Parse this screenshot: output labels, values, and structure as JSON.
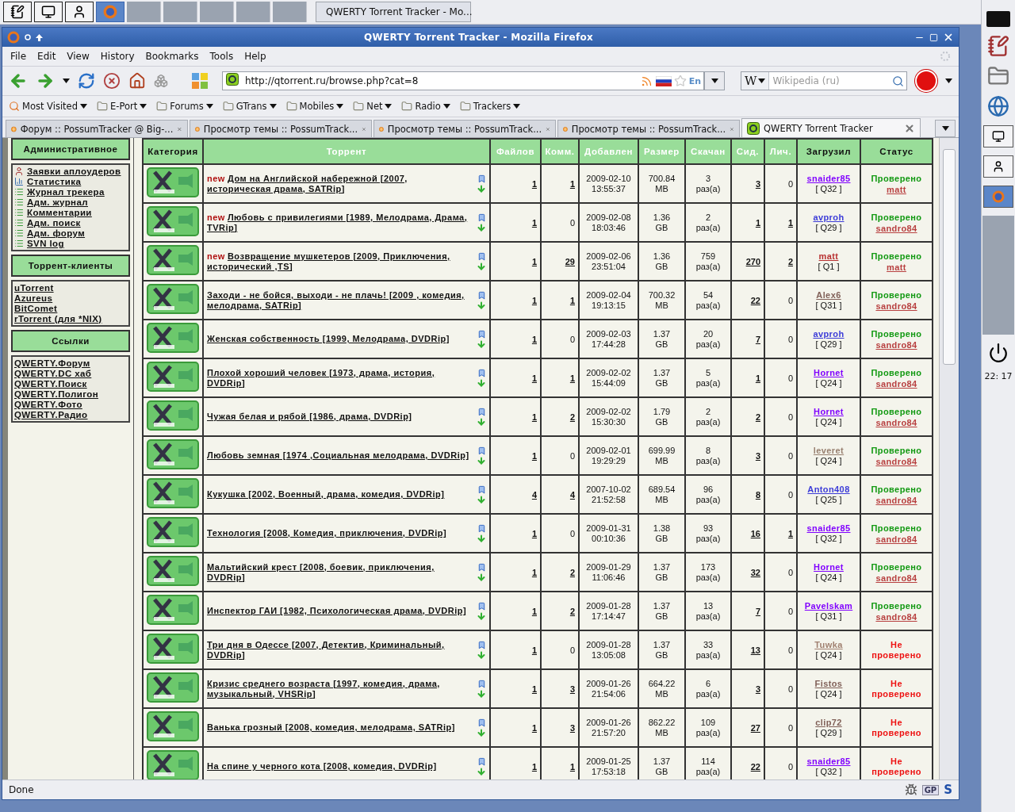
{
  "taskbar": {
    "task": {
      "title": "QWERTY Torrent Tracker - Mo...",
      "selected": true
    }
  },
  "window": {
    "title": "QWERTY Torrent Tracker - Mozilla Firefox"
  },
  "menu": [
    "File",
    "Edit",
    "View",
    "History",
    "Bookmarks",
    "Tools",
    "Help"
  ],
  "navbar": {
    "url": "http://qtorrent.ru/browse.php?cat=8",
    "lang_badge": "En",
    "search_engine": "W",
    "search_placeholder": "Wikipedia (ru)"
  },
  "bookmarks": [
    {
      "label": "Most Visited",
      "kind": "smart"
    },
    {
      "label": "E-Port",
      "kind": "folder"
    },
    {
      "label": "Forums",
      "kind": "folder"
    },
    {
      "label": "GTrans",
      "kind": "folder"
    },
    {
      "label": "Mobiles",
      "kind": "folder"
    },
    {
      "label": "Net",
      "kind": "folder"
    },
    {
      "label": "Radio",
      "kind": "folder"
    },
    {
      "label": "Trackers",
      "kind": "folder"
    }
  ],
  "tabs": [
    {
      "label": "Форум :: PossumTracker @ Big-...",
      "selected": false,
      "kind": "forum"
    },
    {
      "label": "Просмотр темы :: PossumTrack...",
      "selected": false,
      "kind": "forum"
    },
    {
      "label": "Просмотр темы :: PossumTrack...",
      "selected": false,
      "kind": "forum"
    },
    {
      "label": "Просмотр темы :: PossumTrack...",
      "selected": false,
      "kind": "forum"
    },
    {
      "label": "QWERTY Torrent Tracker",
      "selected": true,
      "kind": "tracker"
    }
  ],
  "sidebar": [
    {
      "title": "Административное",
      "items": [
        {
          "label": "Заявки аплоудеров",
          "kind": "user"
        },
        {
          "label": "Статистика",
          "kind": "stats"
        },
        {
          "label": "Журнал трекера",
          "kind": "log"
        },
        {
          "label": "Адм. журнал",
          "kind": "log"
        },
        {
          "label": "Комментарии",
          "kind": "log"
        },
        {
          "label": "Адм. поиск",
          "kind": "log"
        },
        {
          "label": "Адм. форум",
          "kind": "log"
        },
        {
          "label": "SVN log",
          "kind": "log"
        }
      ]
    },
    {
      "title": "Торрент-клиенты",
      "items": [
        {
          "label": "uTorrent",
          "kind": "plain"
        },
        {
          "label": "Azureus",
          "kind": "plain"
        },
        {
          "label": "BitComet",
          "kind": "plain"
        },
        {
          "label": "rTorrent (для *NIX)",
          "kind": "plain"
        }
      ]
    },
    {
      "title": "Ссылки",
      "items": [
        {
          "label": "QWERTY.Форум",
          "kind": "plain"
        },
        {
          "label": "QWERTY.DC хаб",
          "kind": "plain"
        },
        {
          "label": "QWERTY.Поиск",
          "kind": "plain"
        },
        {
          "label": "QWERTY.Полигон",
          "kind": "plain"
        },
        {
          "label": "QWERTY.Фото",
          "kind": "plain"
        },
        {
          "label": "QWERTY.Радио",
          "kind": "plain"
        }
      ]
    }
  ],
  "table": {
    "columns": [
      {
        "label": "Категория",
        "kind": "plain"
      },
      {
        "label": "Торрент",
        "kind": "sort"
      },
      {
        "label": "Файлов",
        "kind": "sort"
      },
      {
        "label": "Комм.",
        "kind": "sort"
      },
      {
        "label": "Добавлен",
        "kind": "sort"
      },
      {
        "label": "Размер",
        "kind": "sort"
      },
      {
        "label": "Скачан",
        "kind": "sort"
      },
      {
        "label": "Сид.",
        "kind": "sort"
      },
      {
        "label": "Лич.",
        "kind": "sort"
      },
      {
        "label": "Загрузил",
        "kind": "plain"
      },
      {
        "label": "Статус",
        "kind": "plain"
      }
    ],
    "rows": [
      {
        "badge": "new",
        "title": "Дом на Английской набережной [2007, историческая драма, SATRip]",
        "files": "1",
        "comments": "1",
        "added": "2009-02-10 13:55:37",
        "size": "700.84 MB",
        "downloaded": "3 раз(а)",
        "seeders": "3",
        "leechers": "0",
        "uploader": {
          "name": "snaider85",
          "color": "#8000ff",
          "rank": "[ Q32 ]"
        },
        "status": {
          "verified": true,
          "text": "Проверено",
          "by": "matt"
        }
      },
      {
        "badge": "new",
        "title": "Любовь с привилегиями [1989, Мелодрама, Драма, TVRip]",
        "files": "1",
        "comments": "0",
        "added": "2009-02-08 18:03:46",
        "size": "1.36 GB",
        "downloaded": "2 раз(а)",
        "seeders": "1",
        "leechers": "1",
        "uploader": {
          "name": "avproh",
          "color": "#3c3cd8",
          "rank": "[ Q29 ]"
        },
        "status": {
          "verified": true,
          "text": "Проверено",
          "by": "sandro84"
        }
      },
      {
        "badge": "new",
        "title": "Возвращение мушкетеров [2009, Приключения, исторический ,TS]",
        "files": "1",
        "comments": "29",
        "added": "2009-02-06 23:51:04",
        "size": "1.36 GB",
        "downloaded": "759 раз(а)",
        "seeders": "270",
        "leechers": "2",
        "uploader": {
          "name": "matt",
          "color": "#b83030",
          "rank": "[ Q1 ]"
        },
        "status": {
          "verified": true,
          "text": "Проверено",
          "by": "matt"
        }
      },
      {
        "title": "Заходи - не бойся, выходи - не плачь! [2009 , комедия, мелодрама, SATRip]",
        "files": "1",
        "comments": "1",
        "added": "2009-02-04 19:13:15",
        "size": "700.32 MB",
        "downloaded": "54 раз(а)",
        "seeders": "22",
        "leechers": "0",
        "uploader": {
          "name": "Alex6",
          "color": "#806058",
          "rank": "[ Q31 ]"
        },
        "status": {
          "verified": true,
          "text": "Проверено",
          "by": "sandro84"
        }
      },
      {
        "title": "Женская собственность [1999, Мелодрама, DVDRip]",
        "files": "1",
        "comments": "0",
        "added": "2009-02-03 17:44:28",
        "size": "1.37 GB",
        "downloaded": "20 раз(а)",
        "seeders": "7",
        "leechers": "0",
        "uploader": {
          "name": "avproh",
          "color": "#3c3cd8",
          "rank": "[ Q29 ]"
        },
        "status": {
          "verified": true,
          "text": "Проверено",
          "by": "sandro84"
        }
      },
      {
        "title": "Плохой хороший человек [1973, драма, история, DVDRip]",
        "files": "1",
        "comments": "1",
        "added": "2009-02-02 15:44:09",
        "size": "1.37 GB",
        "downloaded": "5 раз(а)",
        "seeders": "1",
        "leechers": "0",
        "uploader": {
          "name": "Hornet",
          "color": "#8000ff",
          "rank": "[ Q24 ]"
        },
        "status": {
          "verified": true,
          "text": "Проверено",
          "by": "sandro84"
        }
      },
      {
        "title": "Чужая белая и рябой [1986, драма, DVDRip]",
        "files": "1",
        "comments": "2",
        "added": "2009-02-02 15:30:30",
        "size": "1.79 GB",
        "downloaded": "2 раз(а)",
        "seeders": "2",
        "leechers": "0",
        "uploader": {
          "name": "Hornet",
          "color": "#8000ff",
          "rank": "[ Q24 ]"
        },
        "status": {
          "verified": true,
          "text": "Проверено",
          "by": "sandro84"
        }
      },
      {
        "title": "Любовь земная [1974 ,Социальная мелодрама, DVDRip]",
        "files": "1",
        "comments": "0",
        "added": "2009-02-01 19:29:29",
        "size": "699.99 MB",
        "downloaded": "8 раз(а)",
        "seeders": "3",
        "leechers": "0",
        "uploader": {
          "name": "leveret",
          "color": "#988070",
          "rank": "[ Q24 ]"
        },
        "status": {
          "verified": true,
          "text": "Проверено",
          "by": "sandro84"
        }
      },
      {
        "title": "Кукушка [2002, Военный, драма, комедия, DVDRip]",
        "files": "4",
        "comments": "4",
        "added": "2007-10-02 21:52:58",
        "size": "689.54 MB",
        "downloaded": "96 раз(а)",
        "seeders": "8",
        "leechers": "0",
        "uploader": {
          "name": "Anton408",
          "color": "#3c3cd8",
          "rank": "[ Q25 ]"
        },
        "status": {
          "verified": true,
          "text": "Проверено",
          "by": "sandro84"
        }
      },
      {
        "title": "Технология [2008, Комедия, приключения, DVDRip]",
        "files": "1",
        "comments": "0",
        "added": "2009-01-31 00:10:36",
        "size": "1.38 GB",
        "downloaded": "93 раз(а)",
        "seeders": "16",
        "leechers": "1",
        "uploader": {
          "name": "snaider85",
          "color": "#8000ff",
          "rank": "[ Q32 ]"
        },
        "status": {
          "verified": true,
          "text": "Проверено",
          "by": "sandro84"
        }
      },
      {
        "title": "Мальтийский крест [2008, боевик, приключения, DVDRip]",
        "files": "1",
        "comments": "2",
        "added": "2009-01-29 11:06:46",
        "size": "1.37 GB",
        "downloaded": "173 раз(а)",
        "seeders": "32",
        "leechers": "0",
        "uploader": {
          "name": "Hornet",
          "color": "#8000ff",
          "rank": "[ Q24 ]"
        },
        "status": {
          "verified": true,
          "text": "Проверено",
          "by": "sandro84"
        }
      },
      {
        "title": "Инспектор ГАИ [1982, Психологическая драма, DVDRip]",
        "files": "1",
        "comments": "2",
        "added": "2009-01-28 17:14:47",
        "size": "1.37 GB",
        "downloaded": "13 раз(а)",
        "seeders": "7",
        "leechers": "0",
        "uploader": {
          "name": "Pavelskam",
          "color": "#8000ff",
          "rank": "[ Q31 ]"
        },
        "status": {
          "verified": true,
          "text": "Проверено",
          "by": "sandro84"
        }
      },
      {
        "title": "Три дня в Одессе [2007, Детектив, Криминальный, DVDRip]",
        "files": "1",
        "comments": "0",
        "added": "2009-01-28 13:05:08",
        "size": "1.37 GB",
        "downloaded": "33 раз(а)",
        "seeders": "13",
        "leechers": "0",
        "uploader": {
          "name": "Tuwka",
          "color": "#a08070",
          "rank": "[ Q24 ]"
        },
        "status": {
          "verified": false,
          "text": "Не проверено"
        }
      },
      {
        "title": "Кризис среднего возраста [1997, комедия, драма, музыкальный, VHSRip]",
        "files": "1",
        "comments": "3",
        "added": "2009-01-26 21:54:06",
        "size": "664.22 MB",
        "downloaded": "6 раз(а)",
        "seeders": "3",
        "leechers": "0",
        "uploader": {
          "name": "Fistos",
          "color": "#806058",
          "rank": "[ Q24 ]"
        },
        "status": {
          "verified": false,
          "text": "Не проверено"
        }
      },
      {
        "title": "Ванька грозный [2008, комедия, мелодрама, SATRip]",
        "files": "1",
        "comments": "3",
        "added": "2009-01-26 21:57:20",
        "size": "862.22 MB",
        "downloaded": "109 раз(а)",
        "seeders": "27",
        "leechers": "0",
        "uploader": {
          "name": "clip72",
          "color": "#806058",
          "rank": "[ Q29 ]"
        },
        "status": {
          "verified": false,
          "text": "Не проверено"
        }
      },
      {
        "title": "На спине у черного кота [2008, комедия, DVDRip]",
        "files": "1",
        "comments": "1",
        "added": "2009-01-25 17:53:18",
        "size": "1.37 GB",
        "downloaded": "114 раз(а)",
        "seeders": "22",
        "leechers": "0",
        "uploader": {
          "name": "snaider85",
          "color": "#8000ff",
          "rank": "[ Q32 ]"
        },
        "status": {
          "verified": false,
          "text": "Не проверено"
        }
      }
    ]
  },
  "status_bar": {
    "text": "Done",
    "badges": [
      "GP",
      "S"
    ]
  },
  "dock": {
    "clock": "22: 17"
  }
}
